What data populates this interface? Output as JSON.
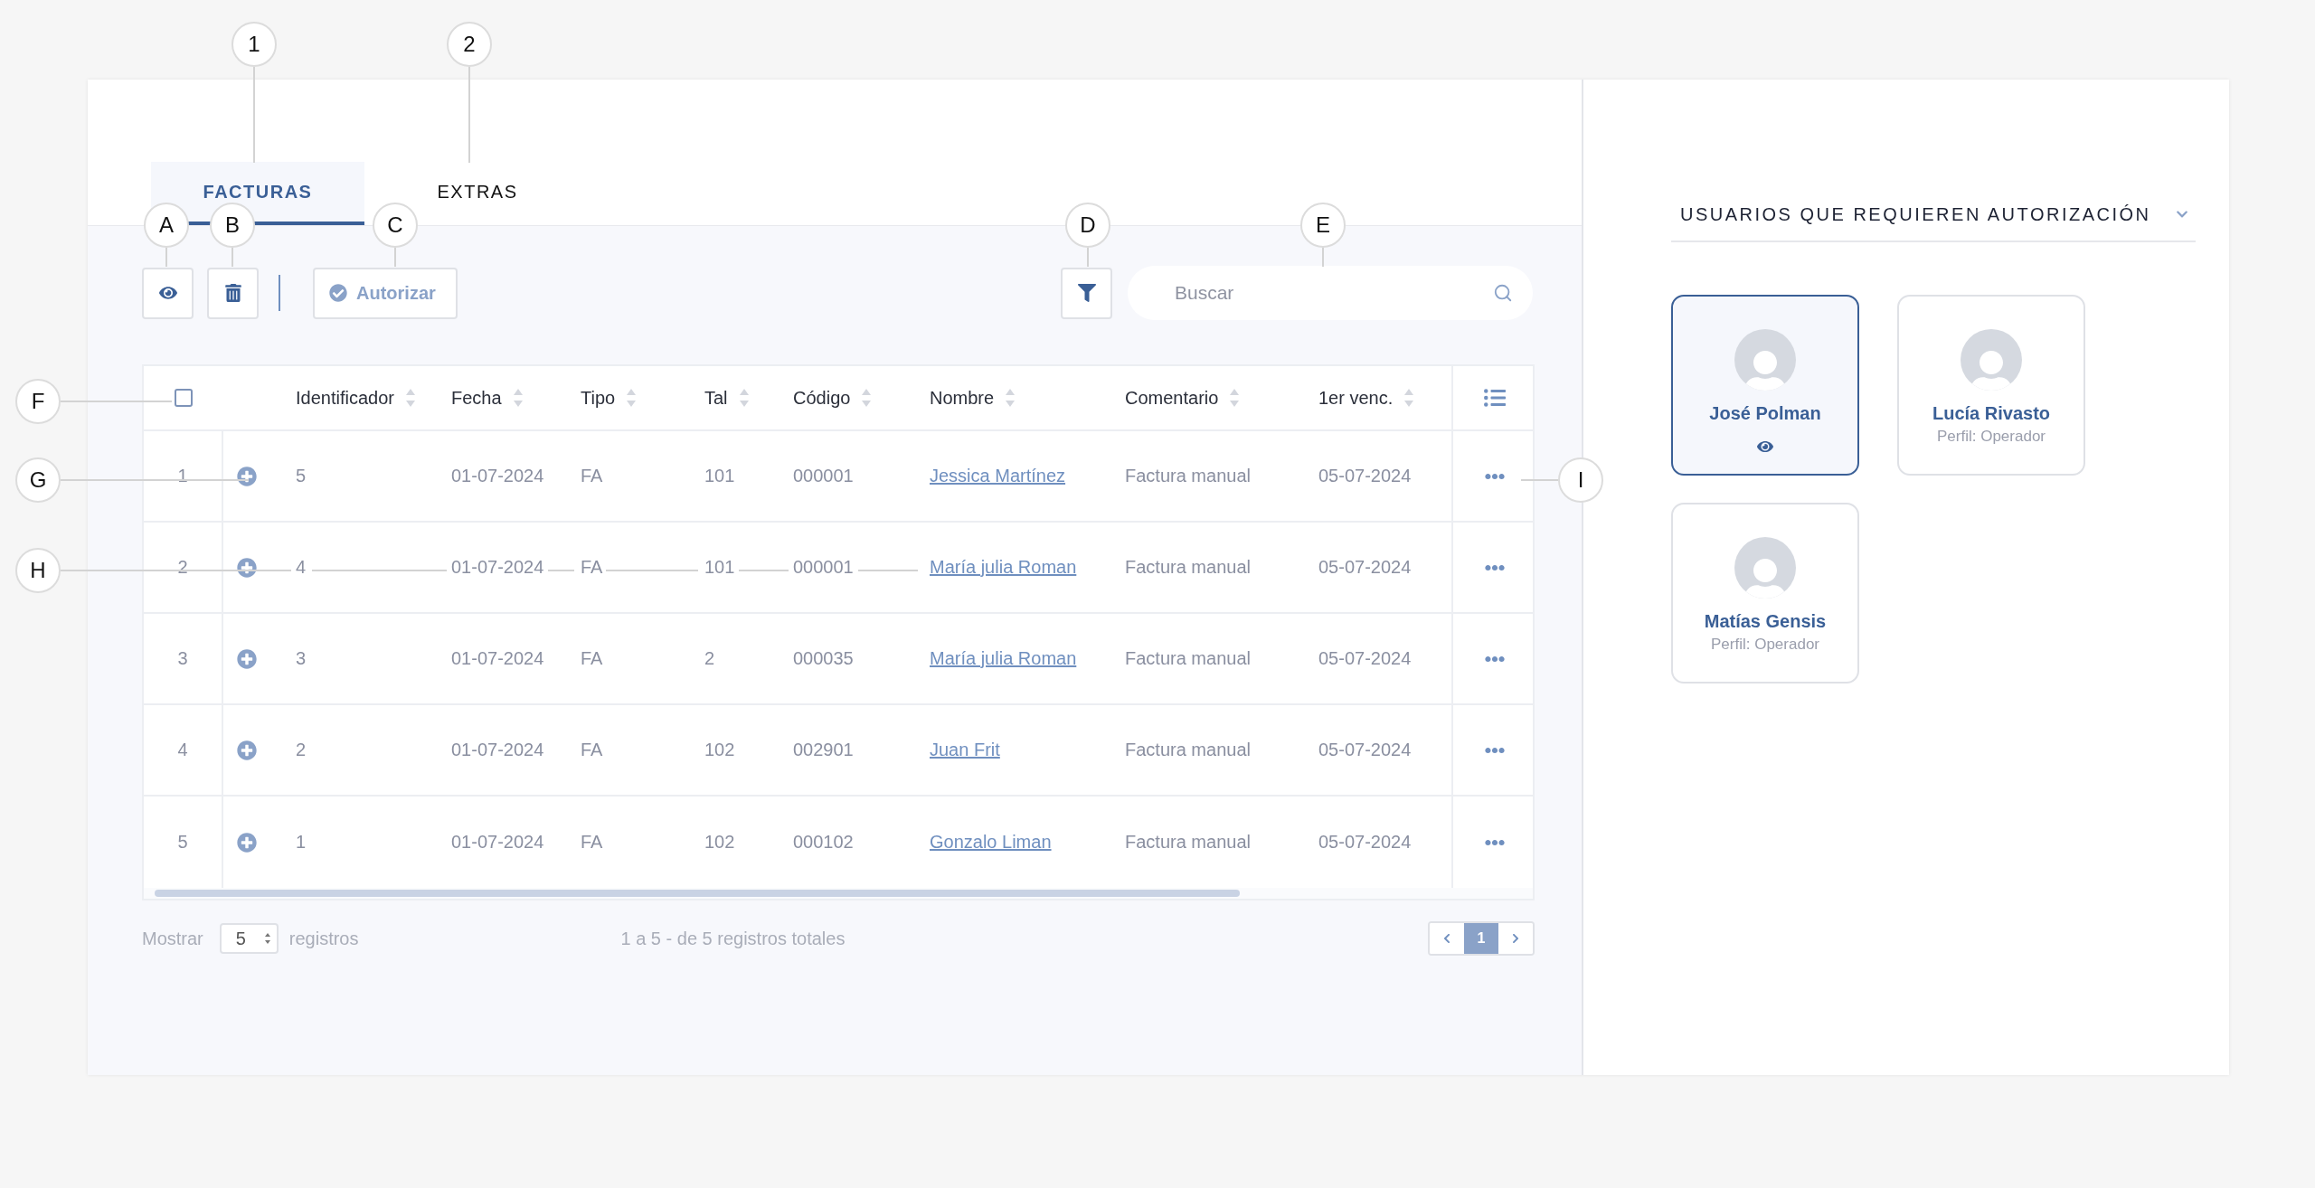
{
  "callouts": [
    {
      "label": "1"
    },
    {
      "label": "2"
    },
    {
      "label": "A"
    },
    {
      "label": "B"
    },
    {
      "label": "C"
    },
    {
      "label": "D"
    },
    {
      "label": "E"
    },
    {
      "label": "F"
    },
    {
      "label": "G"
    },
    {
      "label": "H"
    },
    {
      "label": "I"
    }
  ],
  "tabs": [
    {
      "label": "FACTURAS",
      "selected": true
    },
    {
      "label": "EXTRAS",
      "selected": false
    }
  ],
  "toolbar": {
    "authorize_button": "Autorizar",
    "search": {
      "placeholder": "Buscar"
    }
  },
  "table": {
    "select_all": {
      "checked": false
    },
    "columns": [
      "Identificador",
      "Fecha",
      "Tipo",
      "Tal",
      "Código",
      "Nombre",
      "Comentario",
      "1er venc."
    ],
    "rows": [
      {
        "index": "1",
        "id": "5",
        "date": "01-07-2024",
        "type": "FA",
        "tal": "101",
        "code": "000001",
        "name": "Jessica Martínez",
        "comment": "Factura manual",
        "due": "05-07-2024"
      },
      {
        "index": "2",
        "id": "4",
        "date": "01-07-2024",
        "type": "FA",
        "tal": "101",
        "code": "000001",
        "name": "María julia Roman",
        "comment": "Factura manual",
        "due": "05-07-2024"
      },
      {
        "index": "3",
        "id": "3",
        "date": "01-07-2024",
        "type": "FA",
        "tal": "2",
        "code": "000035",
        "name": "María julia Roman",
        "comment": "Factura manual",
        "due": "05-07-2024"
      },
      {
        "index": "4",
        "id": "2",
        "date": "01-07-2024",
        "type": "FA",
        "tal": "102",
        "code": "002901",
        "name": "Juan Frit",
        "comment": "Factura manual",
        "due": "05-07-2024"
      },
      {
        "index": "5",
        "id": "1",
        "date": "01-07-2024",
        "type": "FA",
        "tal": "102",
        "code": "000102",
        "name": "Gonzalo Liman",
        "comment": "Factura manual",
        "due": "05-07-2024"
      }
    ]
  },
  "footer": {
    "show_label": "Mostrar",
    "page_size": "5",
    "records_label": "registros",
    "summary": "1 a 5 - de 5 registros totales",
    "pages": [
      {
        "label": "1",
        "selected": true
      }
    ]
  },
  "authorization_panel": {
    "title": "USUARIOS QUE REQUIEREN AUTORIZACIÓN",
    "users": [
      {
        "name": "José Polman",
        "selected": true
      },
      {
        "name": "Lucía Rivasto",
        "profile": "Perfil: Operador",
        "selected": false
      },
      {
        "name": "Matías Gensis",
        "profile": "Perfil: Operador",
        "selected": false
      }
    ]
  }
}
